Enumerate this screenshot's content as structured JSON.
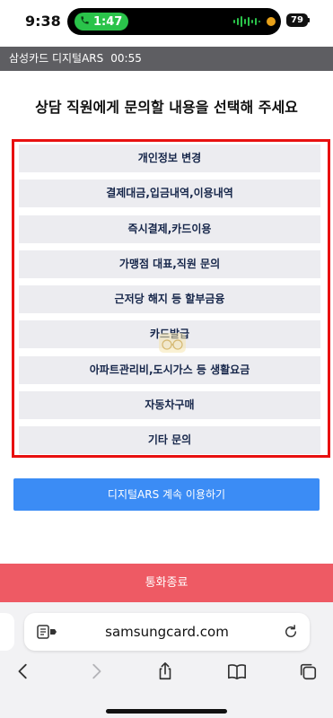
{
  "status_bar": {
    "time": "9:38",
    "call_time": "1:47",
    "battery": "79"
  },
  "ars_header": {
    "title": "삼성카드 디지털ARS",
    "timer": "00:55"
  },
  "prompt": "상담 직원에게 문의할 내용을 선택해 주세요",
  "menu_items": [
    "개인정보 변경",
    "결제대금,입금내역,이용내역",
    "즉시결제,카드이용",
    "가맹점 대표,직원 문의",
    "근저당 해지 등 할부금융",
    "카드발급",
    "아파트관리비,도시가스 등 생활요금",
    "자동차구매",
    "기타 문의"
  ],
  "cta_label": "디지털ARS 계속 이용하기",
  "end_call_label": "통화종료",
  "browser": {
    "url": "samsungcard.com"
  },
  "colors": {
    "header_bg": "#5e5e62",
    "highlight_border": "#e81010",
    "cta_bg": "#3b8cf5",
    "end_call_bg": "#ee5a64",
    "menu_item_bg": "#ececf0"
  },
  "icons": [
    "phone-icon",
    "waveform-icon",
    "reader-icon",
    "reload-icon",
    "back-icon",
    "forward-icon",
    "share-icon",
    "bookmarks-icon",
    "tabs-icon"
  ]
}
